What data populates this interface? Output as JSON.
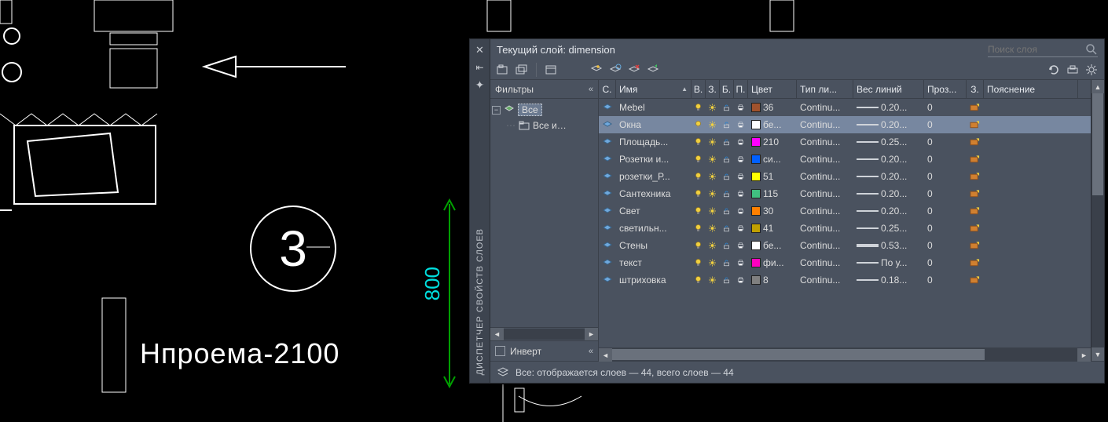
{
  "canvas": {
    "dimension_label": "800",
    "opening_height": "Нпроема-2100",
    "bubble_number": "3"
  },
  "panel": {
    "vertical_label": "ДИСПЕТЧЕР СВОЙСТВ СЛОЕВ",
    "title": "Текущий слой: dimension",
    "search_placeholder": "Поиск слоя",
    "filters_header": "Фильтры",
    "collapse_glyph": "«",
    "tree": {
      "root": "Все",
      "child": "Все и…"
    },
    "invert_label": "Инверт",
    "columns": {
      "status": "С.",
      "name": "Имя",
      "on": "В.",
      "freeze": "З.",
      "lock": "Б.",
      "plot": "П.",
      "color": "Цвет",
      "linetype": "Тип ли...",
      "lineweight": "Вес линий",
      "transparency": "Проз...",
      "plotstyle": "З.",
      "description": "Пояснение"
    },
    "layers": [
      {
        "name": "Mebel",
        "color_swatch": "#a0522d",
        "color_label": "36",
        "linetype": "Continu...",
        "lw": "0.20...",
        "trans": "0"
      },
      {
        "name": "Окна",
        "color_swatch": "#ffffff",
        "color_label": "бе...",
        "linetype": "Continu...",
        "lw": "0.20...",
        "trans": "0",
        "selected": true
      },
      {
        "name": "Площадь...",
        "color_swatch": "#ff00ff",
        "color_label": "210",
        "linetype": "Continu...",
        "lw": "0.25...",
        "trans": "0"
      },
      {
        "name": "Розетки и...",
        "color_swatch": "#0060ff",
        "color_label": "си...",
        "linetype": "Continu...",
        "lw": "0.20...",
        "trans": "0"
      },
      {
        "name": "розетки_Р...",
        "color_swatch": "#ffff00",
        "color_label": "51",
        "linetype": "Continu...",
        "lw": "0.20...",
        "trans": "0"
      },
      {
        "name": "Сантехника",
        "color_swatch": "#40c080",
        "color_label": "115",
        "linetype": "Continu...",
        "lw": "0.20...",
        "trans": "0"
      },
      {
        "name": "Свет",
        "color_swatch": "#ff8000",
        "color_label": "30",
        "linetype": "Continu...",
        "lw": "0.20...",
        "trans": "0"
      },
      {
        "name": "светильн...",
        "color_swatch": "#c0a000",
        "color_label": "41",
        "linetype": "Continu...",
        "lw": "0.25...",
        "trans": "0"
      },
      {
        "name": "Стены",
        "color_swatch": "#ffffff",
        "color_label": "бе...",
        "linetype": "Continu...",
        "lw": "0.53...",
        "trans": "0",
        "lw_thick": 4
      },
      {
        "name": "текст",
        "color_swatch": "#ff00c0",
        "color_label": "фи...",
        "linetype": "Continu...",
        "lw": "По у...",
        "trans": "0"
      },
      {
        "name": "штриховка",
        "color_swatch": "#808080",
        "color_label": "8",
        "linetype": "Continu...",
        "lw": "0.18...",
        "trans": "0"
      }
    ],
    "status_bar": "Все: отображается слоев — 44, всего слоев — 44"
  }
}
